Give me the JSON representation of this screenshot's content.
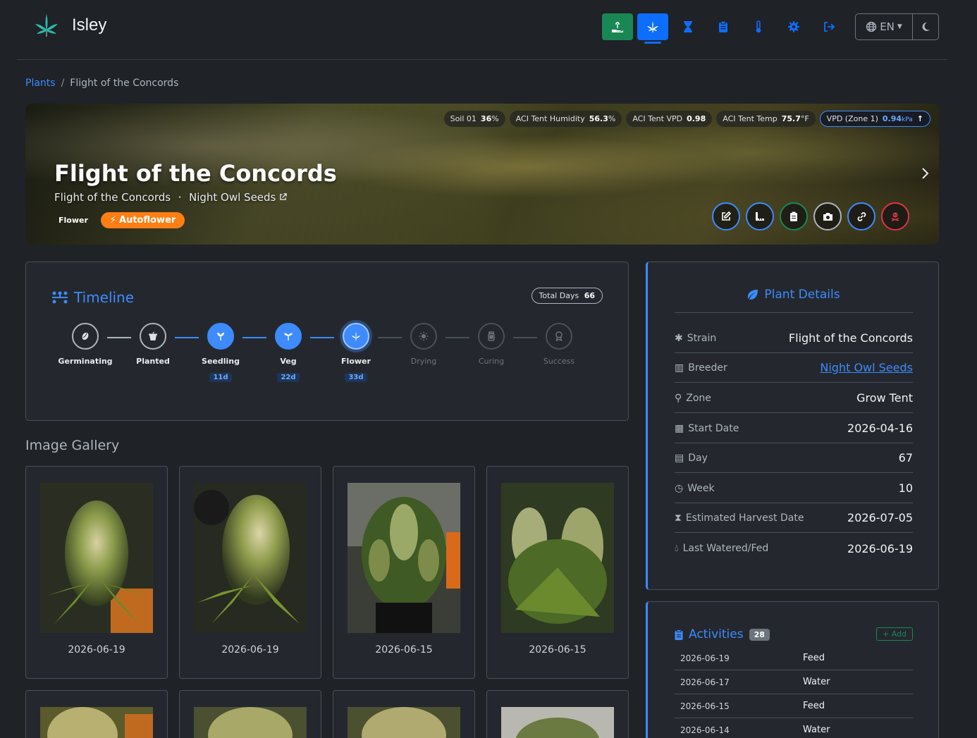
{
  "app": {
    "name": "Isley"
  },
  "nav": {
    "icons": [
      "seedling-hand-icon",
      "cannabis-leaf-icon",
      "hourglass-icon",
      "clipboard-icon",
      "thermometer-icon",
      "gear-icon",
      "logout-icon"
    ],
    "language": "EN"
  },
  "breadcrumb": {
    "root": "Plants",
    "separator": "/",
    "current": "Flight of the Concords"
  },
  "hero": {
    "title": "Flight of the Concords",
    "strain": "Flight of the Concords",
    "separator": "•",
    "breeder": "Night Owl Seeds",
    "status": "Flower",
    "autoflower": "Autoflower",
    "sensors": [
      {
        "label": "Soil 01",
        "value": "36",
        "unit": "%"
      },
      {
        "label": "ACI Tent Humidity",
        "value": "56.3",
        "unit": "%"
      },
      {
        "label": "ACI Tent VPD",
        "value": "0.98",
        "unit": ""
      },
      {
        "label": "ACI Tent Temp",
        "value": "75.7",
        "unit": "°F"
      }
    ],
    "vpd": {
      "label": "VPD (Zone 1)",
      "value": "0.94",
      "unit": "kPa"
    }
  },
  "timeline": {
    "title": "Timeline",
    "total_days_label": "Total Days",
    "total_days": "66",
    "stages": [
      {
        "label": "Germinating",
        "days": "",
        "state": "done"
      },
      {
        "label": "Planted",
        "days": "",
        "state": "done"
      },
      {
        "label": "Seedling",
        "days": "11d",
        "state": "active"
      },
      {
        "label": "Veg",
        "days": "22d",
        "state": "active"
      },
      {
        "label": "Flower",
        "days": "33d",
        "state": "current"
      },
      {
        "label": "Drying",
        "days": "",
        "state": "future"
      },
      {
        "label": "Curing",
        "days": "",
        "state": "future"
      },
      {
        "label": "Success",
        "days": "",
        "state": "future"
      }
    ]
  },
  "gallery": {
    "title": "Image Gallery",
    "images": [
      {
        "date": "2026-06-19"
      },
      {
        "date": "2026-06-19"
      },
      {
        "date": "2026-06-15"
      },
      {
        "date": "2026-06-15"
      }
    ]
  },
  "details": {
    "title": "Plant Details",
    "rows": [
      {
        "label": "Strain",
        "value": "Flight of the Concords"
      },
      {
        "label": "Breeder",
        "value": "Night Owl Seeds"
      },
      {
        "label": "Zone",
        "value": "Grow Tent"
      },
      {
        "label": "Start Date",
        "value": "2026-04-16"
      },
      {
        "label": "Day",
        "value": "67"
      },
      {
        "label": "Week",
        "value": "10"
      },
      {
        "label": "Estimated Harvest Date",
        "value": "2026-07-05"
      },
      {
        "label": "Last Watered/Fed",
        "value": "2026-06-19"
      }
    ]
  },
  "activities": {
    "title": "Activities",
    "count": "28",
    "add_label": "+ Add",
    "rows": [
      {
        "date": "2026-06-19",
        "type": "Feed"
      },
      {
        "date": "2026-06-17",
        "type": "Water"
      },
      {
        "date": "2026-06-15",
        "type": "Feed"
      },
      {
        "date": "2026-06-14",
        "type": "Water"
      }
    ]
  },
  "colors": {
    "accent": "#3d8bfd",
    "success": "#198754",
    "warning": "#fd7e14",
    "bg": "#1f2227"
  }
}
